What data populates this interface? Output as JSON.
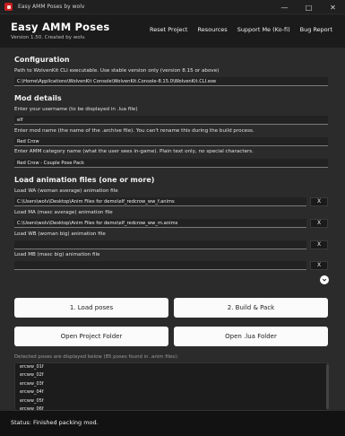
{
  "window": {
    "title": "Easy AMM Poses by wolv"
  },
  "header": {
    "title": "Easy AMM Poses",
    "version": "Version 1.50. Created by wolv.",
    "nav": [
      "Reset Project",
      "Resources",
      "Support Me (Ko-fi)",
      "Bug Report"
    ]
  },
  "configuration": {
    "heading": "Configuration",
    "wolvenkit_label": "Path to WolvenKit CLI executable. Use stable version only (version 8.15 or above)",
    "wolvenkit_value": "C:\\Home\\Applications\\WolvenKit Console\\WolvenKit.Console-8.15.0\\WolvenKit.CLI.exe"
  },
  "mod_details": {
    "heading": "Mod details",
    "username_label": "Enter your username (to be displayed in .lua file)",
    "username_value": "elf",
    "modname_label": "Enter mod name (the name of the .archive file). You can't rename this during the build process.",
    "modname_value": "Red Crow",
    "category_label": "Enter AMM category name (what the user sees in-game). Plain text only, no special characters.",
    "category_value": "Red Crow - Couple Pose Pack"
  },
  "animations": {
    "heading": "Load animation files (one or more)",
    "wa_label": "Load WA (woman average) animation file",
    "wa_value": "C:\\Users\\wolv\\Desktop\\Anim Files for demo\\elf_redcrow_ww_f.anims",
    "ma_label": "Load MA (masc average) animation file",
    "ma_value": "C:\\Users\\wolv\\Desktop\\Anim Files for demo\\elf_redcrow_ww_m.anims",
    "wb_label": "Load WB (woman big) animation file",
    "wb_value": "",
    "mb_label": "Load MB (masc big) animation file",
    "mb_value": "",
    "clear_label": "X"
  },
  "buttons": {
    "load_poses": "1. Load poses",
    "build_pack": "2. Build & Pack",
    "open_project": "Open Project Folder",
    "open_lua": "Open .lua Folder"
  },
  "poses": {
    "caption": "Detected poses are displayed below (85 poses found in .anim files):",
    "items": [
      "ercww_01f",
      "ercww_02f",
      "ercww_03f",
      "ercww_04f",
      "ercww_05f",
      "ercww_06f"
    ]
  },
  "status": {
    "text": "Status: Finished packing mod."
  },
  "icons": {
    "app": "app-icon",
    "minimize": "minimize-icon",
    "maximize": "maximize-icon",
    "close": "close-icon",
    "scroll": "chevron-down-icon"
  },
  "colors": {
    "app_icon": "#c81e1e",
    "button_bg": "#fbfbfb",
    "content_bg": "#2b2b2b",
    "header_bg": "#1b1b1b"
  }
}
